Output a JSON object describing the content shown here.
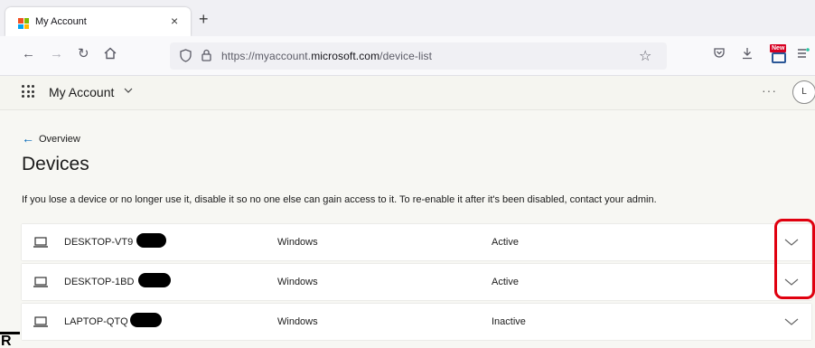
{
  "browser": {
    "tab_title": "My Account",
    "tab_close": "×",
    "new_tab": "+",
    "url_prefix": "https://myaccount.",
    "url_host": "microsoft.com",
    "url_path": "/device-list",
    "extension_badge": "New"
  },
  "app": {
    "title": "My Account",
    "title_chevron": "⌄",
    "more": "···",
    "avatar_initial": "L"
  },
  "page": {
    "back_label": "Overview",
    "title": "Devices",
    "info_text": "If you lose a device or no longer use it, disable it so no one else can gain access to it. To re-enable it after it's been disabled, contact your admin."
  },
  "devices": [
    {
      "name": "DESKTOP-VT9",
      "os": "Windows",
      "status": "Active"
    },
    {
      "name": "DESKTOP-1BD",
      "os": "Windows",
      "status": "Active"
    },
    {
      "name": "LAPTOP-QTQ",
      "os": "Windows",
      "status": "Inactive"
    }
  ],
  "colors": {
    "accent": "#0067b8",
    "highlight": "#e0000f",
    "page_background": "#f7f7f3"
  },
  "corner_text": "R"
}
